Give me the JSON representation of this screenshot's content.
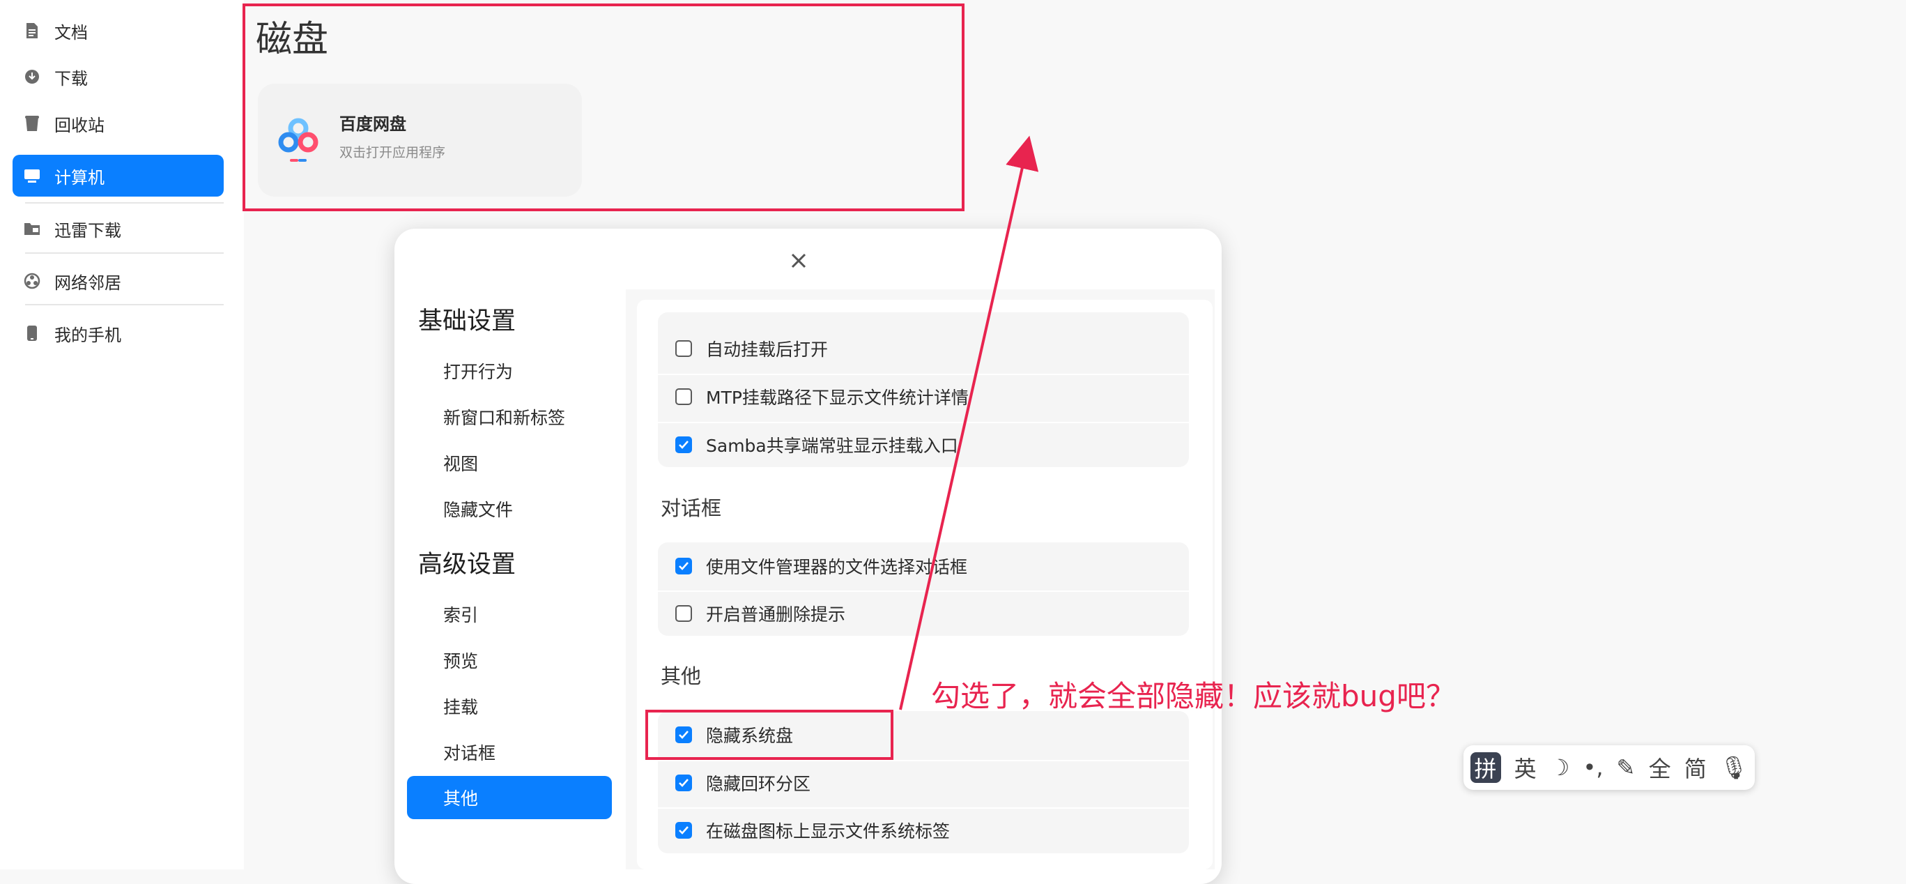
{
  "sidebar": {
    "items": [
      {
        "label": "文档"
      },
      {
        "label": "下载"
      },
      {
        "label": "回收站"
      },
      {
        "label": "计算机"
      },
      {
        "label": "迅雷下载"
      },
      {
        "label": "网络邻居"
      },
      {
        "label": "我的手机"
      }
    ]
  },
  "main": {
    "title": "磁盘",
    "card": {
      "name": "百度网盘",
      "desc": "双击打开应用程序"
    }
  },
  "dialog": {
    "nav": {
      "basic_heading": "基础设置",
      "basic_items": [
        "打开行为",
        "新窗口和新标签",
        "视图",
        "隐藏文件"
      ],
      "advanced_heading": "高级设置",
      "advanced_items": [
        "索引",
        "预览",
        "挂载",
        "对话框",
        "其他"
      ]
    },
    "mount_options": [
      {
        "label": "自动挂载后打开",
        "checked": false
      },
      {
        "label": "MTP挂载路径下显示文件统计详情",
        "checked": false
      },
      {
        "label": "Samba共享端常驻显示挂载入口",
        "checked": true
      }
    ],
    "dialog_section_title": "对话框",
    "dialog_options": [
      {
        "label": "使用文件管理器的文件选择对话框",
        "checked": true
      },
      {
        "label": "开启普通删除提示",
        "checked": false
      }
    ],
    "other_section_title": "其他",
    "other_options": [
      {
        "label": "隐藏系统盘",
        "checked": true
      },
      {
        "label": "隐藏回环分区",
        "checked": true
      },
      {
        "label": "在磁盘图标上显示文件系统标签",
        "checked": true
      }
    ]
  },
  "annotation": {
    "text": "勾选了，就会全部隐藏！应该就bug吧？"
  },
  "ime": {
    "items": [
      "拼",
      "英",
      "☽",
      "•,",
      "✎",
      "全",
      "简",
      "🎙"
    ]
  },
  "colors": {
    "accent": "#0a7fff",
    "annotation": "#e8244f"
  }
}
